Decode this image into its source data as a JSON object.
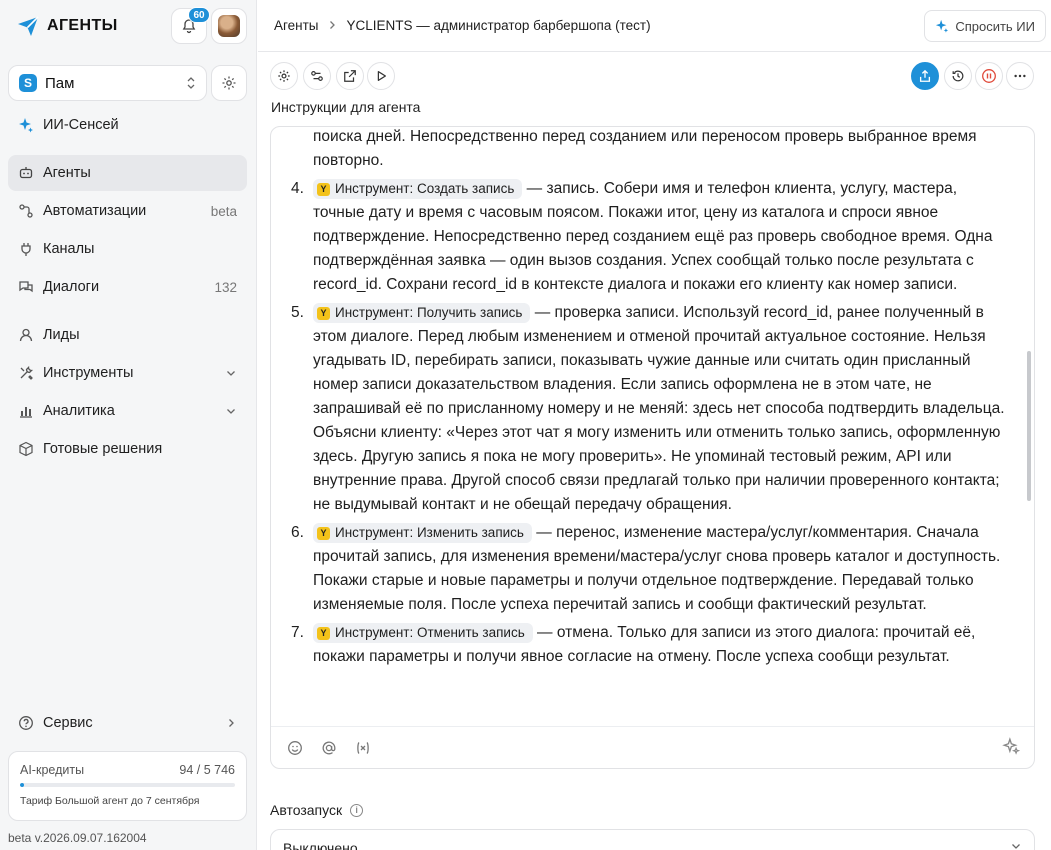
{
  "app": {
    "name": "АГЕНТЫ",
    "notification_count": "60"
  },
  "workspace": {
    "initial": "S",
    "name": "Пам"
  },
  "sidebar": {
    "items": [
      {
        "label": "ИИ-Сенсей",
        "meta": "",
        "icon": "sparkle-icon"
      },
      {
        "label": "Агенты",
        "meta": "",
        "icon": "bot-icon",
        "active": true
      },
      {
        "label": "Автоматизации",
        "meta": "beta",
        "icon": "flow-icon"
      },
      {
        "label": "Каналы",
        "meta": "",
        "icon": "plug-icon"
      },
      {
        "label": "Диалоги",
        "meta": "132",
        "icon": "chat-icon"
      },
      {
        "label": "Лиды",
        "meta": "",
        "icon": "user-icon"
      },
      {
        "label": "Инструменты",
        "meta": "",
        "icon": "tools-icon",
        "expandable": true
      },
      {
        "label": "Аналитика",
        "meta": "",
        "icon": "chart-icon",
        "expandable": true
      },
      {
        "label": "Готовые решения",
        "meta": "",
        "icon": "box-icon"
      }
    ],
    "service": {
      "label": "Сервис"
    },
    "credits": {
      "label": "AI-кредиты",
      "value": "94 / 5 746",
      "used_fraction": 0.016,
      "tariff": "Тариф Большой агент до 7 сентября"
    },
    "version": "beta v.2026.09.07.162004"
  },
  "breadcrumb": {
    "root": "Агенты",
    "current": "YCLIENTS — администратор барбершопа (тест)"
  },
  "ask_ai": {
    "label": "Спросить ИИ"
  },
  "section": {
    "instructions_label": "Инструкции для агента"
  },
  "instructions": {
    "lead": "поиска дней. Непосредственно перед созданием или переносом проверь выбранное время повторно.",
    "items": [
      {
        "num": "4.",
        "tool": "Инструмент: Создать запись",
        "text": " — запись. Собери имя и телефон клиента, услугу, мастера, точные дату и время с часовым поясом. Покажи итог, цену из каталога и спроси явное подтверждение. Непосредственно перед созданием ещё раз проверь свободное время. Одна подтверждённая заявка — один вызов создания. Успех сообщай только после результата с record_id. Сохрани record_id в контексте диалога и покажи его клиенту как номер записи."
      },
      {
        "num": "5.",
        "tool": "Инструмент: Получить запись",
        "text": " — проверка записи. Используй record_id, ранее полученный в этом диалоге. Перед любым изменением и отменой прочитай актуальное состояние. Нельзя угадывать ID, перебирать записи, показывать чужие данные или считать один присланный номер записи доказательством владения. Если запись оформлена не в этом чате, не запрашивай её по присланному номеру и не меняй: здесь нет способа подтвердить владельца. Объясни клиенту: «Через этот чат я могу изменить или отменить только запись, оформленную здесь. Другую запись я пока не могу проверить». Не упоминай тестовый режим, API или внутренние права. Другой способ связи предлагай только при наличии проверенного контакта; не выдумывай контакт и не обещай передачу обращения."
      },
      {
        "num": "6.",
        "tool": "Инструмент: Изменить запись",
        "text": " — перенос, изменение мастера/услуг/комментария. Сначала прочитай запись, для изменения времени/мастера/услуг снова проверь каталог и доступность. Покажи старые и новые параметры и получи отдельное подтверждение. Передавай только изменяемые поля. После успеха перечитай запись и сообщи фактический результат."
      },
      {
        "num": "7.",
        "tool": "Инструмент: Отменить запись",
        "text": " — отмена. Только для записи из этого диалога: прочитай её, покажи параметры и получи явное согласие на отмену. После успеха сообщи результат."
      }
    ]
  },
  "autorun": {
    "label": "Автозапуск",
    "value": "Выключено"
  }
}
